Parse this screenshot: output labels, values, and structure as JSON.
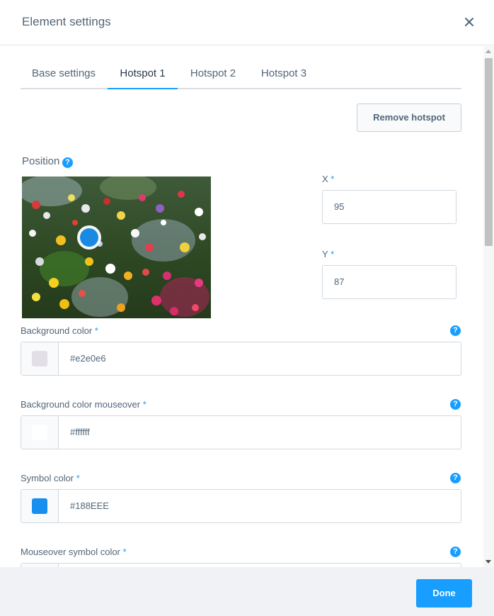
{
  "header": {
    "title": "Element settings"
  },
  "tabs": [
    {
      "label": "Base settings"
    },
    {
      "label": "Hotspot 1"
    },
    {
      "label": "Hotspot 2"
    },
    {
      "label": "Hotspot 3"
    }
  ],
  "remove_hotspot_label": "Remove hotspot",
  "position": {
    "label": "Position",
    "x_label": "X",
    "x_value": "95",
    "y_label": "Y",
    "y_value": "87"
  },
  "required_mark": "*",
  "help_glyph": "?",
  "fields": {
    "background_color": {
      "label": "Background color",
      "value": "#e2e0e6",
      "swatch": "#e2e0e6"
    },
    "background_color_mouseover": {
      "label": "Background color mouseover",
      "value": "#ffffff",
      "swatch": "#ffffff"
    },
    "symbol_color": {
      "label": "Symbol color",
      "value": "#188EEE",
      "swatch": "#188EEE"
    },
    "mouseover_symbol_color": {
      "label": "Mouseover symbol color"
    }
  },
  "footer": {
    "done_label": "Done"
  },
  "colors": {
    "accent": "#189eff",
    "text": "#52667a",
    "footer_bg": "#f0f2f5"
  }
}
